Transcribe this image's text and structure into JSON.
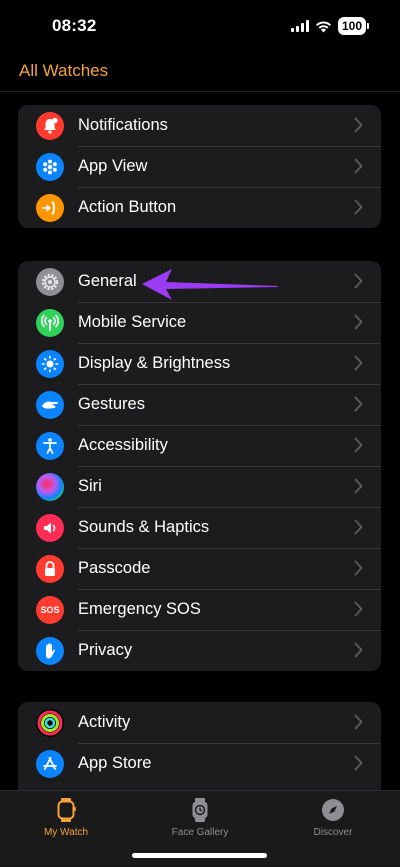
{
  "status": {
    "time": "08:32",
    "battery": "100"
  },
  "nav": {
    "back_label": "All Watches"
  },
  "group1": [
    {
      "label": "Notifications",
      "icon": "bell-badge-icon",
      "color": "#ff3b30"
    },
    {
      "label": "App View",
      "icon": "app-grid-icon",
      "color": "#0a84ff"
    },
    {
      "label": "Action Button",
      "icon": "action-button-icon",
      "color": "#ff9500"
    }
  ],
  "group2": [
    {
      "label": "General",
      "icon": "gear-icon",
      "color": "#8e8e93"
    },
    {
      "label": "Mobile Service",
      "icon": "antenna-icon",
      "color": "#30d158"
    },
    {
      "label": "Display & Brightness",
      "icon": "sun-icon",
      "color": "#0a84ff"
    },
    {
      "label": "Gestures",
      "icon": "gesture-hand-icon",
      "color": "#0a84ff"
    },
    {
      "label": "Accessibility",
      "icon": "accessibility-icon",
      "color": "#0a84ff"
    },
    {
      "label": "Siri",
      "icon": "siri-icon",
      "color": "#1c1c1e"
    },
    {
      "label": "Sounds & Haptics",
      "icon": "speaker-icon",
      "color": "#ff2d55"
    },
    {
      "label": "Passcode",
      "icon": "lock-icon",
      "color": "#ff3b30"
    },
    {
      "label": "Emergency SOS",
      "icon": "sos-icon",
      "color": "#ff3b30",
      "icon_text": "SOS"
    },
    {
      "label": "Privacy",
      "icon": "raised-hand-icon",
      "color": "#0a84ff"
    }
  ],
  "group3": [
    {
      "label": "Activity",
      "icon": "activity-rings-icon",
      "color": "#000000"
    },
    {
      "label": "App Store",
      "icon": "app-store-icon",
      "color": "#0a84ff"
    }
  ],
  "tabs": [
    {
      "label": "My Watch",
      "icon": "watch-icon",
      "active": true
    },
    {
      "label": "Face Gallery",
      "icon": "watch-face-icon",
      "active": false
    },
    {
      "label": "Discover",
      "icon": "compass-icon",
      "active": false
    }
  ],
  "colors": {
    "accent": "#f6a23b",
    "annotation": "#9b3cf5"
  }
}
